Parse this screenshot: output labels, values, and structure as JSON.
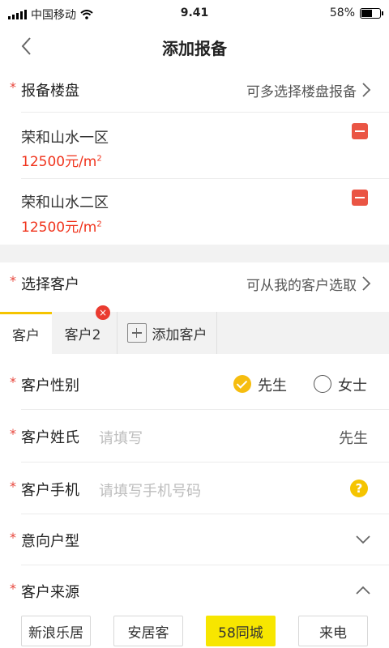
{
  "status": {
    "carrier": "中国移动",
    "time": "9.41",
    "battery": "58%",
    "battery_level": 0.58
  },
  "nav": {
    "title": "添加报备"
  },
  "report_estate": {
    "label": "报备楼盘",
    "hint": "可多选择楼盘报备"
  },
  "estates": [
    {
      "name": "荣和山水一区",
      "price": "12500元/m",
      "unit_sup": "2"
    },
    {
      "name": "荣和山水二区",
      "price": "12500元/m",
      "unit_sup": "2"
    }
  ],
  "select_customer": {
    "label": "选择客户",
    "hint": "可从我的客户选取"
  },
  "tabs": {
    "tab1": "客户",
    "tab2": "客户2",
    "tab2_close": "×",
    "add": "添加客户"
  },
  "gender": {
    "label": "客户性别",
    "male": "先生",
    "female": "女士",
    "selected": "male"
  },
  "surname": {
    "label": "客户姓氏",
    "placeholder": "请填写",
    "suffix": "先生"
  },
  "phone": {
    "label": "客户手机",
    "placeholder": "请填写手机号码",
    "help": "?"
  },
  "house_type": {
    "label": "意向户型"
  },
  "source": {
    "label": "客户来源",
    "options": [
      "新浪乐居",
      "安居客",
      "58同城",
      "来电"
    ],
    "selected_index": 2
  },
  "required_mark": "*",
  "colors": {
    "accent": "#f5c400",
    "price": "#f0341d",
    "remove": "#ea5544"
  }
}
